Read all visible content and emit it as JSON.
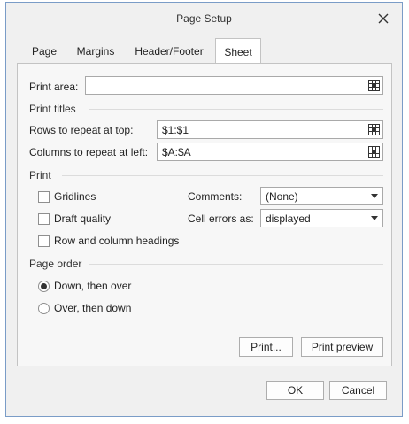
{
  "window": {
    "title": "Page Setup"
  },
  "tabs": [
    {
      "label": "Page"
    },
    {
      "label": "Margins"
    },
    {
      "label": "Header/Footer"
    },
    {
      "label": "Sheet"
    }
  ],
  "active_tab": "Sheet",
  "print_area": {
    "label": "Print area:",
    "value": ""
  },
  "print_titles": {
    "section": "Print titles",
    "rows_label": "Rows to repeat at top:",
    "rows_value": "$1:$1",
    "cols_label": "Columns to repeat at left:",
    "cols_value": "$A:$A"
  },
  "print": {
    "section": "Print",
    "gridlines": {
      "label": "Gridlines",
      "checked": false
    },
    "draft_quality": {
      "label": "Draft quality",
      "checked": false
    },
    "row_col_headings": {
      "label": "Row and column headings",
      "checked": false
    },
    "comments": {
      "label": "Comments:",
      "value": "(None)"
    },
    "cell_errors": {
      "label": "Cell errors as:",
      "value": "displayed"
    }
  },
  "page_order": {
    "section": "Page order",
    "down_then_over": {
      "label": "Down, then over",
      "selected": true
    },
    "over_then_down": {
      "label": "Over, then down",
      "selected": false
    }
  },
  "buttons": {
    "print": "Print...",
    "print_preview": "Print preview",
    "ok": "OK",
    "cancel": "Cancel"
  },
  "icons": {
    "close": "close-icon",
    "range_picker": "range-picker-icon"
  }
}
